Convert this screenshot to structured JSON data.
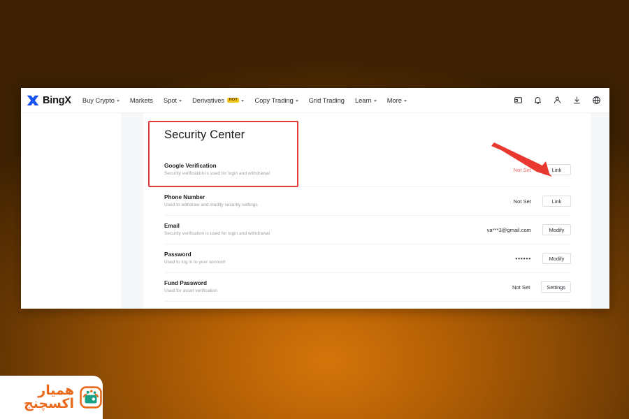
{
  "brand": {
    "name": "BingX",
    "logo_icon": "bingx-x-logo",
    "logo_color": "#1652f0"
  },
  "nav": {
    "items": [
      {
        "label": "Buy Crypto",
        "has_caret": true,
        "badge": null
      },
      {
        "label": "Markets",
        "has_caret": false,
        "badge": null
      },
      {
        "label": "Spot",
        "has_caret": true,
        "badge": null
      },
      {
        "label": "Derivatives",
        "has_caret": true,
        "badge": "HOT"
      },
      {
        "label": "Copy Trading",
        "has_caret": true,
        "badge": null
      },
      {
        "label": "Grid Trading",
        "has_caret": false,
        "badge": null
      },
      {
        "label": "Learn",
        "has_caret": true,
        "badge": null
      },
      {
        "label": "More",
        "has_caret": true,
        "badge": null
      }
    ],
    "icons": [
      {
        "name": "wallet-icon"
      },
      {
        "name": "bell-icon"
      },
      {
        "name": "user-icon"
      },
      {
        "name": "download-icon"
      },
      {
        "name": "globe-icon"
      }
    ],
    "badge_color": "#f5c518"
  },
  "page": {
    "title": "Security Center"
  },
  "security_rows": [
    {
      "title": "Google Verification",
      "desc": "Security verification is used for login and withdrawal",
      "status": "Not Set",
      "status_style": "muted-red",
      "button": "Link"
    },
    {
      "title": "Phone Number",
      "desc": "Used to withdraw and modify security settings",
      "status": "Not Set",
      "status_style": "normal",
      "button": "Link"
    },
    {
      "title": "Email",
      "desc": "Security verification is used for login and withdrawal",
      "status": "va***3@gmail.com",
      "status_style": "normal",
      "button": "Modify"
    },
    {
      "title": "Password",
      "desc": "Used to log in to your account",
      "status": "••••••",
      "status_style": "dots",
      "button": "Modify"
    },
    {
      "title": "Fund Password",
      "desc": "Used for asset verification",
      "status": "Not Set",
      "status_style": "normal",
      "button": "Settings"
    }
  ],
  "annotations": {
    "highlight_box_color": "#e23b3b",
    "arrow_color": "#e8382f",
    "arrow_target": "Link"
  },
  "watermark": {
    "text": "همیار اکسچنج",
    "text_color": "#e8691b",
    "icon": "wallet-exchange-icon",
    "icon_border_color": "#e8691b",
    "icon_fill_color": "#1aa085"
  },
  "background": {
    "accent": "#d4750a"
  }
}
